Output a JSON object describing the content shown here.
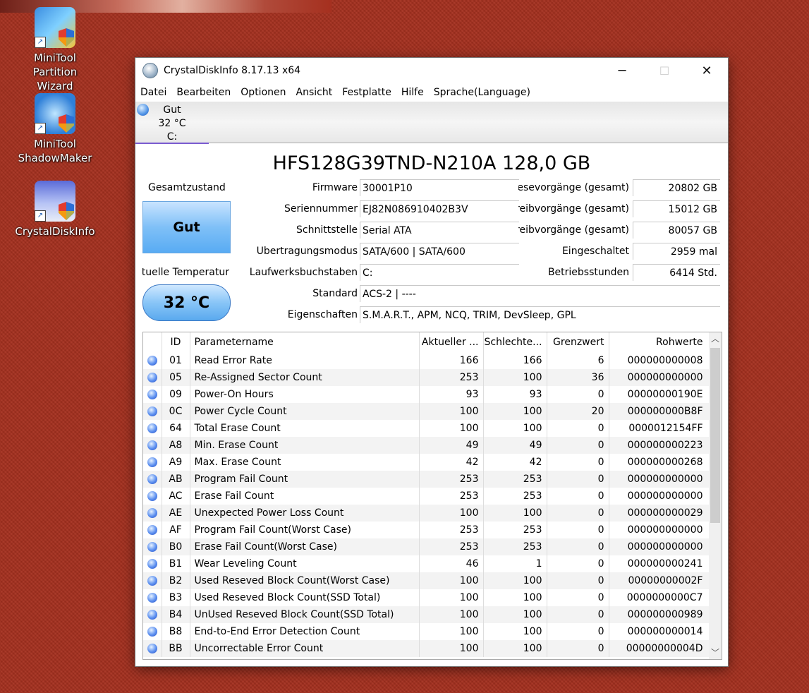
{
  "desktop": {
    "icons": [
      {
        "label_line1": "MiniTool Partition",
        "label_line2": "Wizard"
      },
      {
        "label_line1": "MiniTool",
        "label_line2": "ShadowMaker"
      },
      {
        "label_line1": "CrystalDiskInfo",
        "label_line2": ""
      }
    ]
  },
  "window": {
    "title": "CrystalDiskInfo 8.17.13 x64",
    "minimize": "─",
    "maximize": "☐",
    "close": "✕"
  },
  "menu": [
    "Datei",
    "Bearbeiten",
    "Optionen",
    "Ansicht",
    "Festplatte",
    "Hilfe",
    "Sprache(Language)"
  ],
  "drive_tab": {
    "status": "Gut",
    "temp": "32 °C",
    "letter": "C:"
  },
  "disk": {
    "model": "HFS128G39TND-N210A 128,0 GB",
    "health_label": "Gesamtzustand",
    "health": "Gut",
    "temp_label": "Aktuelle Temperatur",
    "temp": "32 °C"
  },
  "info_left": [
    {
      "label": "Firmware",
      "value": "30001P10"
    },
    {
      "label": "Seriennummer",
      "value": "EJ82N086910402B3V"
    },
    {
      "label": "Schnittstelle",
      "value": "Serial ATA"
    },
    {
      "label": "Übertragungsmodus",
      "value": "SATA/600 | SATA/600"
    },
    {
      "label": "Laufwerksbuchstaben",
      "value": "C:"
    }
  ],
  "info_right": [
    {
      "label": "Lesevorgänge (gesamt)",
      "value": "20802 GB"
    },
    {
      "label": "Schreibvorgänge (gesamt)",
      "value": "15012 GB"
    },
    {
      "label": "Schreibvorgänge (gesamt)",
      "value": "80057 GB"
    },
    {
      "label": "Eingeschaltet",
      "value": "2959 mal"
    },
    {
      "label": "Betriebsstunden",
      "value": "6414 Std."
    }
  ],
  "info_wide": [
    {
      "label": "Standard",
      "value": "ACS-2 | ----"
    },
    {
      "label": "Eigenschaften",
      "value": "S.M.A.R.T., APM, NCQ, TRIM, DevSleep, GPL"
    }
  ],
  "smart": {
    "headers": [
      "",
      "ID",
      "Parametername",
      "Aktueller ...",
      "Schlechte...",
      "Grenzwert",
      "Rohwerte"
    ],
    "rows": [
      [
        "01",
        "Read Error Rate",
        "166",
        "166",
        "6",
        "000000000008"
      ],
      [
        "05",
        "Re-Assigned Sector Count",
        "253",
        "100",
        "36",
        "000000000000"
      ],
      [
        "09",
        "Power-On Hours",
        "93",
        "93",
        "0",
        "00000000190E"
      ],
      [
        "0C",
        "Power Cycle Count",
        "100",
        "100",
        "20",
        "000000000B8F"
      ],
      [
        "64",
        "Total Erase Count",
        "100",
        "100",
        "0",
        "0000012154FF"
      ],
      [
        "A8",
        "Min. Erase Count",
        "49",
        "49",
        "0",
        "000000000223"
      ],
      [
        "A9",
        "Max. Erase Count",
        "42",
        "42",
        "0",
        "000000000268"
      ],
      [
        "AB",
        "Program Fail Count",
        "253",
        "253",
        "0",
        "000000000000"
      ],
      [
        "AC",
        "Erase Fail Count",
        "253",
        "253",
        "0",
        "000000000000"
      ],
      [
        "AE",
        "Unexpected Power Loss Count",
        "100",
        "100",
        "0",
        "000000000029"
      ],
      [
        "AF",
        "Program Fail Count(Worst Case)",
        "253",
        "253",
        "0",
        "000000000000"
      ],
      [
        "B0",
        "Erase Fail Count(Worst Case)",
        "253",
        "253",
        "0",
        "000000000000"
      ],
      [
        "B1",
        "Wear Leveling Count",
        "46",
        "1",
        "0",
        "000000000241"
      ],
      [
        "B2",
        "Used Reseved Block Count(Worst Case)",
        "100",
        "100",
        "0",
        "00000000002F"
      ],
      [
        "B3",
        "Used Reseved Block Count(SSD Total)",
        "100",
        "100",
        "0",
        "0000000000C7"
      ],
      [
        "B4",
        "UnUsed Reseved Block Count(SSD Total)",
        "100",
        "100",
        "0",
        "000000000989"
      ],
      [
        "B8",
        "End-to-End Error Detection Count",
        "100",
        "100",
        "0",
        "000000000014"
      ],
      [
        "BB",
        "Uncorrectable Error Count",
        "100",
        "100",
        "0",
        "00000000004D"
      ]
    ]
  }
}
